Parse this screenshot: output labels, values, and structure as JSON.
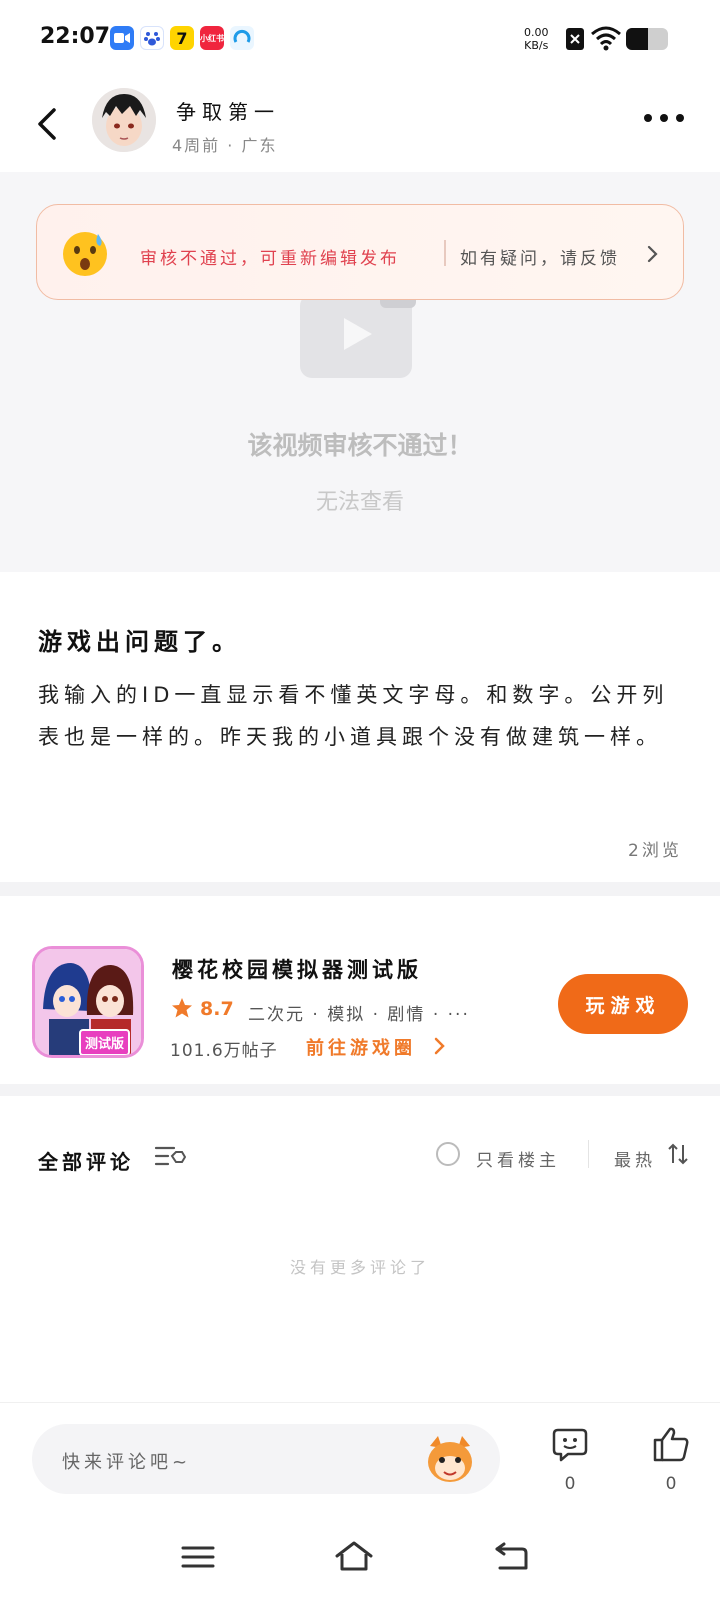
{
  "status_bar": {
    "time": "22:07",
    "net_speed_value": "0.00",
    "net_speed_unit": "KB/s",
    "app_icons": [
      "video-call-app-icon",
      "baidu-app-icon",
      "seven-app-icon",
      "xiaohongshu-app-icon",
      "browser-app-icon"
    ],
    "xiaohongshu_label": "小红书"
  },
  "header": {
    "username": "争取第一",
    "meta": "4周前 · 广东"
  },
  "video": {
    "notice_text": "审核不通过，可重新编辑发布",
    "notice_link": "如有疑问，请反馈",
    "title": "该视频审核不通过！",
    "subtitle": "无法查看"
  },
  "post": {
    "title": "游戏出问题了。",
    "body": "我输入的ID一直显示看不懂英文字母。和数字。公开列表也是一样的。昨天我的小道具跟个没有做建筑一样。",
    "views": "2浏览"
  },
  "game": {
    "name": "樱花校园模拟器测试版",
    "score": "8.7",
    "tags": "二次元 · 模拟 · 剧情 · ···",
    "posts": "101.6万帖子",
    "goto_label": "前往游戏圈",
    "play_label": "玩游戏",
    "icon_badge": "测试版",
    "accent_color": "#f06a18"
  },
  "comments": {
    "title": "全部评论",
    "only_owner": "只看楼主",
    "sort_label": "最热",
    "empty_text": "没有更多评论了"
  },
  "bottom": {
    "input_placeholder": "快来评论吧~",
    "comment_count": "0",
    "like_count": "0"
  }
}
